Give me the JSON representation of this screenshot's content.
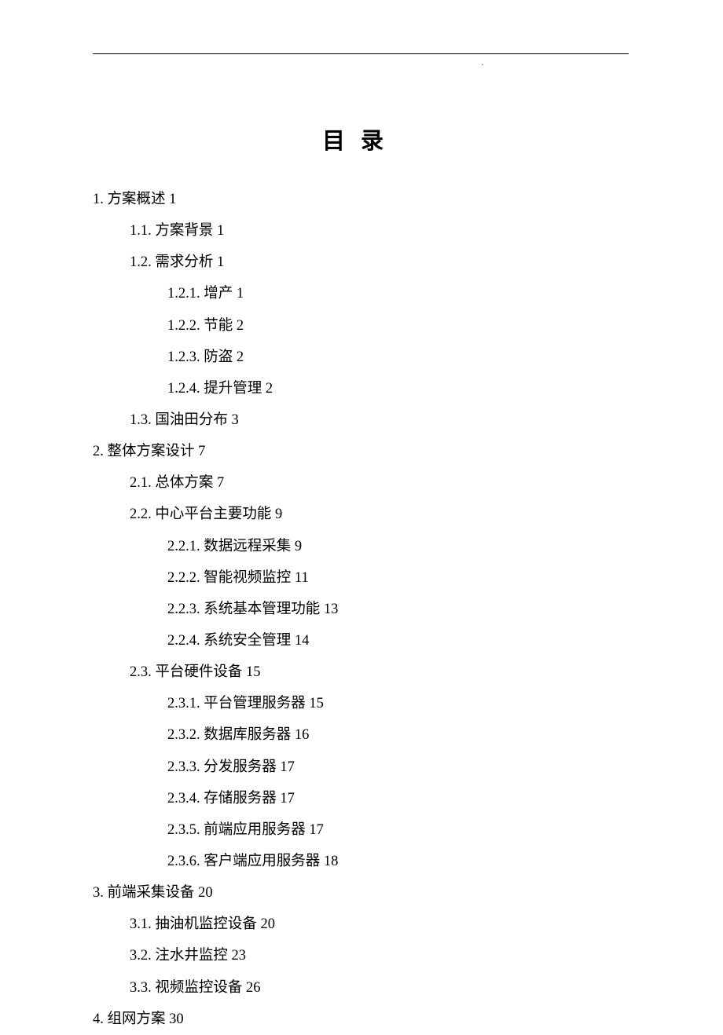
{
  "title": "目录",
  "header_dot": ".",
  "toc": [
    {
      "level": 0,
      "label": "1. 方案概述 1"
    },
    {
      "level": 1,
      "label": "1.1. 方案背景 1"
    },
    {
      "level": 1,
      "label": "1.2. 需求分析 1"
    },
    {
      "level": 2,
      "label": "1.2.1. 增产 1"
    },
    {
      "level": 2,
      "label": "1.2.2. 节能 2"
    },
    {
      "level": 2,
      "label": "1.2.3. 防盗 2"
    },
    {
      "level": 2,
      "label": "1.2.4. 提升管理 2"
    },
    {
      "level": 1,
      "label": "1.3. 国油田分布 3"
    },
    {
      "level": 0,
      "label": "2. 整体方案设计 7"
    },
    {
      "level": 1,
      "label": "2.1. 总体方案 7"
    },
    {
      "level": 1,
      "label": "2.2. 中心平台主要功能 9"
    },
    {
      "level": 2,
      "label": "2.2.1. 数据远程采集 9"
    },
    {
      "level": 2,
      "label": "2.2.2. 智能视频监控 11"
    },
    {
      "level": 2,
      "label": "2.2.3. 系统基本管理功能 13"
    },
    {
      "level": 2,
      "label": "2.2.4. 系统安全管理 14"
    },
    {
      "level": 1,
      "label": "2.3. 平台硬件设备 15"
    },
    {
      "level": 2,
      "label": "2.3.1. 平台管理服务器 15"
    },
    {
      "level": 2,
      "label": "2.3.2. 数据库服务器 16"
    },
    {
      "level": 2,
      "label": "2.3.3. 分发服务器 17"
    },
    {
      "level": 2,
      "label": "2.3.4. 存储服务器 17"
    },
    {
      "level": 2,
      "label": "2.3.5. 前端应用服务器 17"
    },
    {
      "level": 2,
      "label": "2.3.6. 客户端应用服务器 18"
    },
    {
      "level": 0,
      "label": "3. 前端采集设备 20"
    },
    {
      "level": 1,
      "label": "3.1. 抽油机监控设备 20"
    },
    {
      "level": 1,
      "label": "3.2. 注水井监控 23"
    },
    {
      "level": 1,
      "label": "3.3. 视频监控设备 26"
    },
    {
      "level": 0,
      "label": "4. 组网方案 30"
    }
  ]
}
